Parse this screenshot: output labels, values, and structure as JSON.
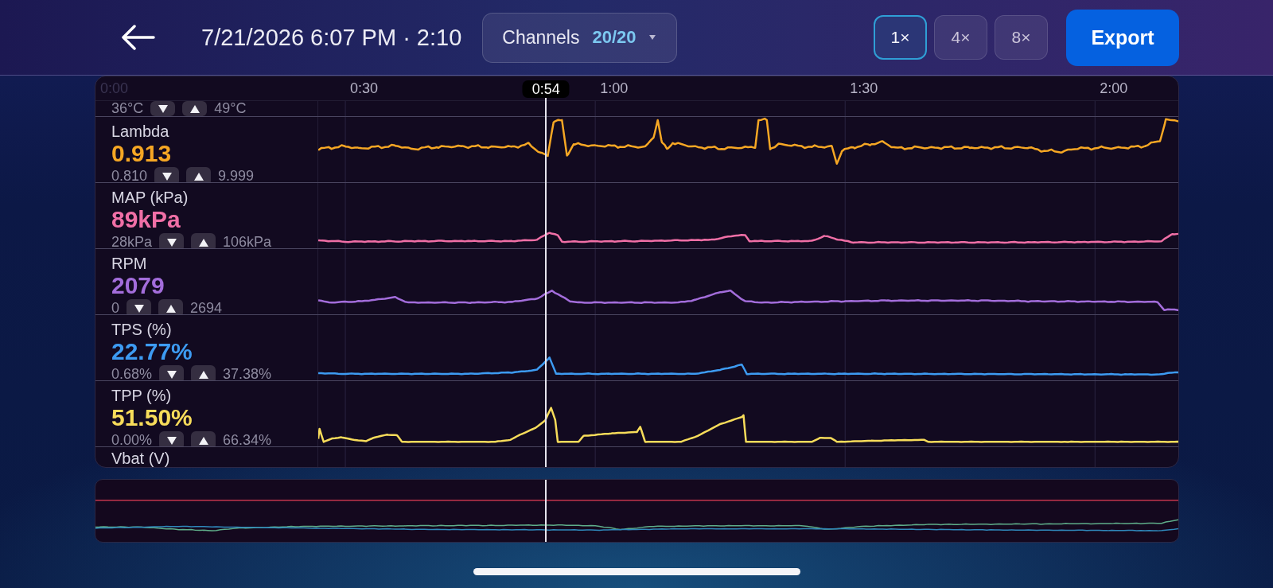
{
  "header": {
    "title": "7/21/2026 6:07 PM · 2:10",
    "channels_button": {
      "label": "Channels",
      "count": "20/20"
    },
    "zoom_options": [
      {
        "label": "1×",
        "selected": true
      },
      {
        "label": "4×",
        "selected": false
      },
      {
        "label": "8×",
        "selected": false
      }
    ],
    "export_button": "Export"
  },
  "time_axis": {
    "ticks": [
      "0:00",
      "0:30",
      "1:00",
      "1:30",
      "2:00"
    ],
    "cursor": {
      "label": "0:54",
      "level": 0.416
    }
  },
  "channels": [
    {
      "kind": "range",
      "min": "36°C",
      "max": "49°C"
    },
    {
      "kind": "full",
      "label": "Lambda",
      "value": "0.913",
      "color": "#f6a724",
      "min": "0.810",
      "max": "9.999"
    },
    {
      "kind": "full",
      "label": "MAP (kPa)",
      "value": "89kPa",
      "color": "#f06fa6",
      "min": "28kPa",
      "max": "106kPa"
    },
    {
      "kind": "full",
      "label": "RPM",
      "value": "2079",
      "color": "#a36ddb",
      "min": "0",
      "max": "2694"
    },
    {
      "kind": "full",
      "label": "TPS (%)",
      "value": "22.77%",
      "color": "#3d9bf2",
      "min": "0.68%",
      "max": "37.38%"
    },
    {
      "kind": "full",
      "label": "TPP (%)",
      "value": "51.50%",
      "color": "#f7dc5a",
      "min": "0.00%",
      "max": "66.34%"
    },
    {
      "kind": "label",
      "label": "Vbat (V)"
    }
  ]
}
